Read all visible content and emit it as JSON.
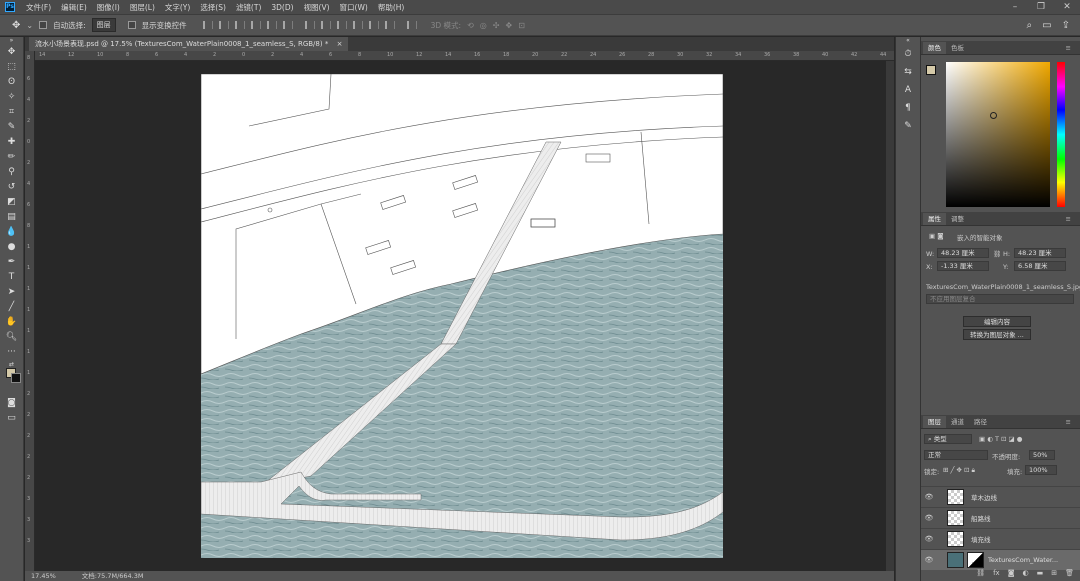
{
  "app": {
    "logo": "Ps"
  },
  "menu": [
    "文件(F)",
    "编辑(E)",
    "图像(I)",
    "图层(L)",
    "文字(Y)",
    "选择(S)",
    "滤镜(T)",
    "3D(D)",
    "视图(V)",
    "窗口(W)",
    "帮助(H)"
  ],
  "options": {
    "auto_select_label": "自动选择:",
    "auto_select_value": "图层",
    "transform_label": "显示变换控件",
    "mode_label": "3D 模式:"
  },
  "document": {
    "tab_title": "流水小场景表现.psd @ 17.5% (TexturesCom_WaterPlain0008_1_seamless_S, RGB/8) *",
    "tab_close": "×",
    "zoom": "17.45%",
    "doc_size": "文档:75.7M/664.3M"
  },
  "rulers": {
    "h": [
      "14",
      "12",
      "10",
      "8",
      "6",
      "4",
      "2",
      "0",
      "2",
      "4",
      "6",
      "8",
      "10",
      "12",
      "14",
      "16",
      "18",
      "20",
      "22",
      "24",
      "26",
      "28",
      "30",
      "32",
      "34",
      "36",
      "38",
      "40",
      "42",
      "44"
    ],
    "v": [
      "8",
      "6",
      "4",
      "2",
      "0",
      "2",
      "4",
      "6",
      "8",
      "1",
      "1",
      "1",
      "1",
      "1",
      "1",
      "1",
      "2",
      "2",
      "2",
      "2",
      "2",
      "3",
      "3",
      "3"
    ]
  },
  "color_panel": {
    "tabs": [
      "颜色",
      "色板"
    ]
  },
  "properties": {
    "tabs": [
      "属性",
      "调整"
    ],
    "object_type": "嵌入的智能对象",
    "w_label": "W:",
    "w_value": "48.23 厘米",
    "h_label": "H:",
    "h_value": "48.23 厘米",
    "x_label": "X:",
    "x_value": "-1.33 厘米",
    "y_label": "Y:",
    "y_value": "6.58 厘米",
    "source_file": "TexturesCom_WaterPlain0008_1_seamless_S.jpg",
    "comp_placeholder": "不应用图层复合",
    "edit_button": "编辑内容",
    "convert_button": "转换为图层对象 ..."
  },
  "layers": {
    "tabs": [
      "图层",
      "通道",
      "路径"
    ],
    "filter_label": "类型",
    "blend_mode": "正常",
    "opacity_label": "不透明度:",
    "opacity_value": "50%",
    "lock_label": "锁定:",
    "fill_label": "填充:",
    "fill_value": "100%",
    "items": [
      {
        "name": "草木边线",
        "visible": true,
        "selected": false
      },
      {
        "name": "船路线",
        "visible": true,
        "selected": false
      },
      {
        "name": "填充线",
        "visible": true,
        "selected": false
      },
      {
        "name": "TexturesCom_Water...",
        "visible": true,
        "selected": true
      }
    ]
  },
  "colors": {
    "accent": "#31a8ff",
    "foreground": "#d4c9a8",
    "background": "#111111",
    "water": "#95aeb1"
  }
}
